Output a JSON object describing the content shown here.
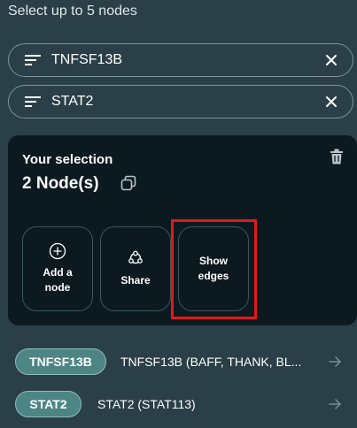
{
  "heading": "Select up to 5 nodes",
  "search_chips": [
    {
      "label": "TNFSF13B",
      "filter_icon": "filter-lines-icon",
      "close_icon": "close-icon"
    },
    {
      "label": "STAT2",
      "filter_icon": "filter-lines-icon",
      "close_icon": "close-icon"
    }
  ],
  "selection_panel": {
    "title": "Your selection",
    "count": "2 Node(s)",
    "copy_icon": "copy-icon",
    "delete_icon": "trash-icon",
    "actions": [
      {
        "label_line1": "Add a",
        "label_line2": "node",
        "icon": "plus-circle-icon"
      },
      {
        "label_line1": "Share",
        "label_line2": "",
        "icon": "share-nodes-icon"
      },
      {
        "label_line1": "Show",
        "label_line2": "edges",
        "icon": ""
      }
    ]
  },
  "node_rows": [
    {
      "pill": "TNFSF13B",
      "description": "TNFSF13B (BAFF, THANK, BL...",
      "arrow_icon": "arrow-right-icon"
    },
    {
      "pill": "STAT2",
      "description": "STAT2 (STAT113)",
      "arrow_icon": "arrow-right-icon"
    }
  ],
  "colors": {
    "background": "#2a3f47",
    "panel": "#0c1a20",
    "pill": "#4d8585",
    "highlight": "#e0191c"
  }
}
